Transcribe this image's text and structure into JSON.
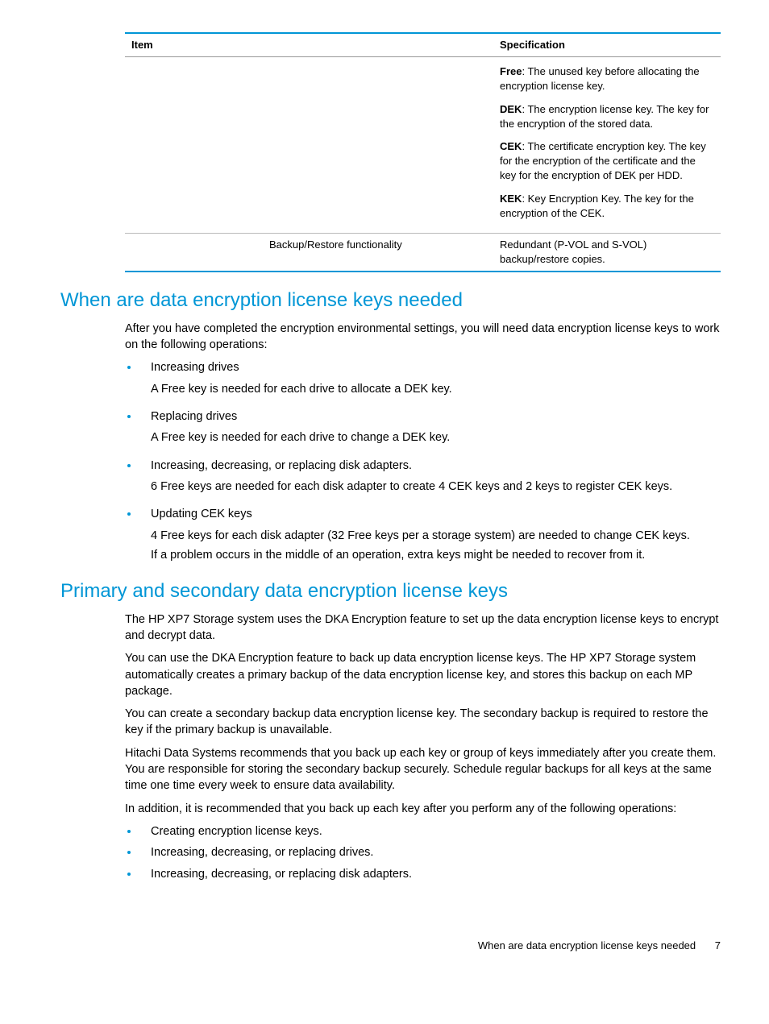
{
  "table": {
    "headers": {
      "item": "Item",
      "spec": "Specification"
    },
    "row1": {
      "free_label": "Free",
      "free_text": ": The unused key before allocating the encryption license key.",
      "dek_label": "DEK",
      "dek_text": ": The encryption license key. The key for the encryption of the stored data.",
      "cek_label": "CEK",
      "cek_text": ": The certificate encryption key. The key for the encryption of the certificate and the key for the encryption of DEK per HDD.",
      "kek_label": "KEK",
      "kek_text": ": Key Encryption Key. The key for the encryption of the CEK."
    },
    "row2": {
      "item": "Backup/Restore functionality",
      "spec": "Redundant (P-VOL and S-VOL) backup/restore copies."
    }
  },
  "section1": {
    "heading": "When are data encryption license keys needed",
    "intro": "After you have completed the encryption environmental settings, you will need data encryption license keys to work on the following operations:",
    "items": {
      "i0": {
        "title": "Increasing drives",
        "p0": "A Free key is needed for each drive to allocate a DEK key."
      },
      "i1": {
        "title": "Replacing drives",
        "p0": "A Free key is needed for each drive to change a DEK key."
      },
      "i2": {
        "title": "Increasing, decreasing, or replacing disk adapters.",
        "p0": "6 Free keys are needed for each disk adapter to create 4 CEK keys and 2 keys to register CEK keys."
      },
      "i3": {
        "title": "Updating CEK keys",
        "p0": "4 Free keys for each disk adapter (32 Free keys per a storage system) are needed to change CEK keys.",
        "p1": "If a problem occurs in the middle of an operation, extra keys might be needed to recover from it."
      }
    }
  },
  "section2": {
    "heading": "Primary and secondary data encryption license keys",
    "p0": "The HP XP7 Storage system uses the DKA Encryption feature to set up the data encryption license keys to encrypt and decrypt data.",
    "p1": "You can use the DKA Encryption feature to back up data encryption license keys. The HP XP7 Storage system automatically creates a primary backup of the data encryption license key, and stores this backup on each MP package.",
    "p2": "You can create a secondary backup data encryption license key. The secondary backup is required to restore the key if the primary backup is unavailable.",
    "p3": "Hitachi Data Systems recommends that you back up each key or group of keys immediately after you create them. You are responsible for storing the secondary backup securely. Schedule regular backups for all keys at the same time one time every week to ensure data availability.",
    "p4": "In addition, it is recommended that you back up each key after you perform any of the following operations:",
    "bullets": {
      "b0": "Creating encryption license keys.",
      "b1": "Increasing, decreasing, or replacing drives.",
      "b2": "Increasing, decreasing, or replacing disk adapters."
    }
  },
  "footer": {
    "text": "When are data encryption license keys needed",
    "page": "7"
  }
}
